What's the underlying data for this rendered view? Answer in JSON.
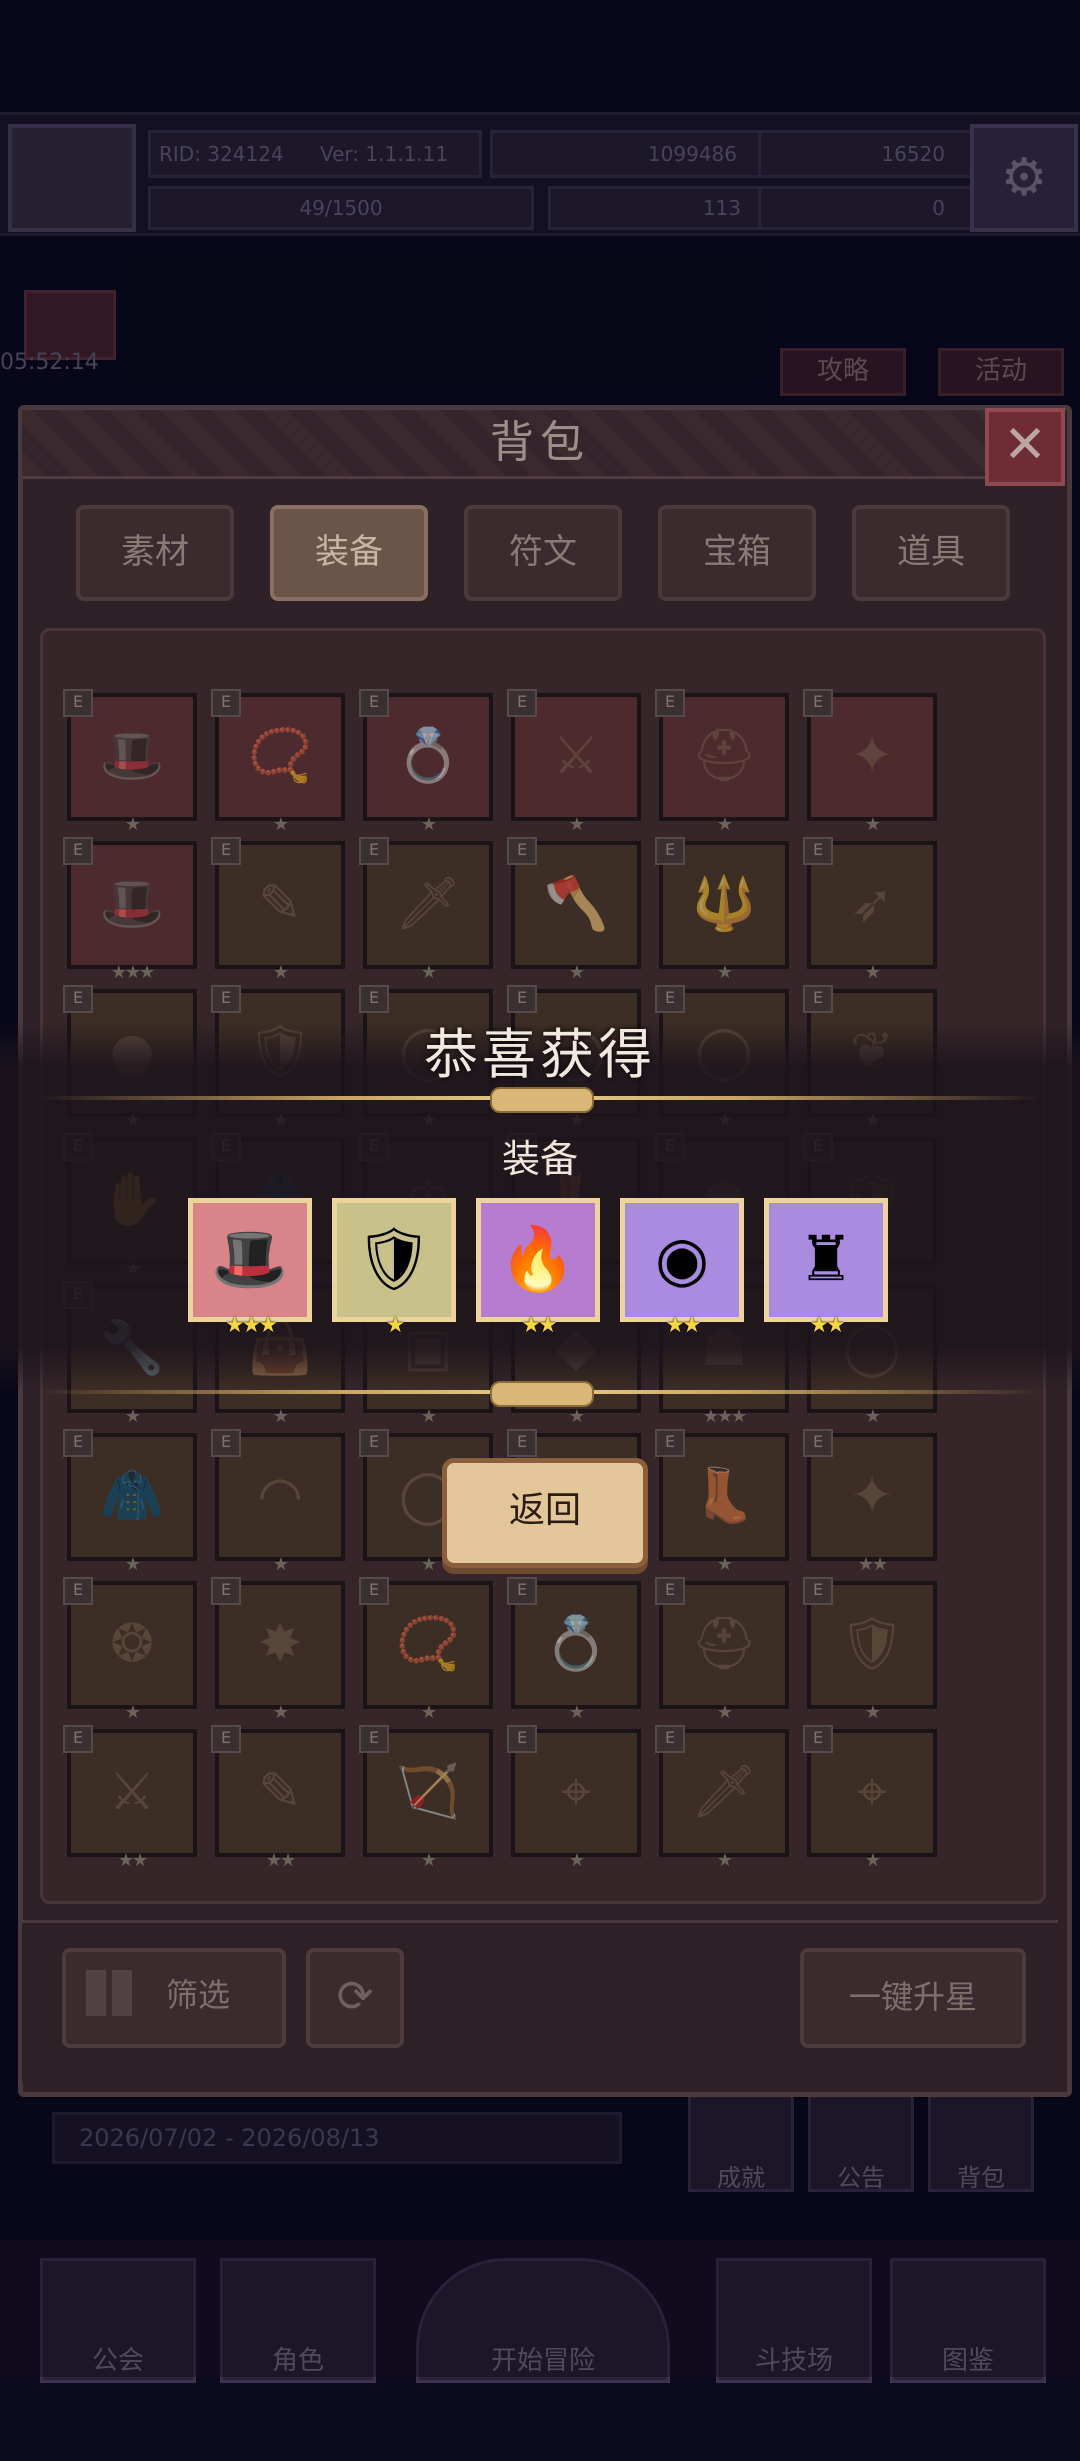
{
  "top_bar": {
    "rid": "RID: 324124",
    "version": "Ver: 1.1.1.11",
    "gold": "1099486",
    "gems": "16520",
    "stamina": "49/1500",
    "clover": "113",
    "key": "0"
  },
  "side": {
    "timer": "05:52:14",
    "guide_label": "攻略",
    "activity_label": "活动"
  },
  "panel": {
    "title": "背包",
    "close_icon": "close-icon",
    "tabs": [
      {
        "label": "素材",
        "active": false
      },
      {
        "label": "装备",
        "active": true
      },
      {
        "label": "符文",
        "active": false
      },
      {
        "label": "宝箱",
        "active": false
      },
      {
        "label": "道具",
        "active": false
      }
    ],
    "grid": [
      [
        {
          "icon": "hat-icon",
          "glyph": "🎩",
          "bg": "red",
          "stars": 1
        },
        {
          "icon": "necklace-icon",
          "glyph": "📿",
          "bg": "red",
          "stars": 1
        },
        {
          "icon": "ring-icon",
          "glyph": "💍",
          "bg": "red",
          "stars": 1
        },
        {
          "icon": "crossed-swords-icon",
          "glyph": "⚔",
          "bg": "red",
          "stars": 1
        },
        {
          "icon": "helmet-icon",
          "glyph": "⛑",
          "bg": "red",
          "stars": 1
        },
        {
          "icon": "amulet-icon",
          "glyph": "✦",
          "bg": "red",
          "stars": 1
        }
      ],
      [
        {
          "icon": "cap-icon",
          "glyph": "🎩",
          "bg": "red",
          "stars": 3
        },
        {
          "icon": "staff-icon",
          "glyph": "✎",
          "bg": "tan",
          "stars": 1
        },
        {
          "icon": "sword-icon",
          "glyph": "🗡",
          "bg": "tan",
          "stars": 1
        },
        {
          "icon": "axe-icon",
          "glyph": "🪓",
          "bg": "tan",
          "stars": 1
        },
        {
          "icon": "trident-icon",
          "glyph": "🔱",
          "bg": "tan",
          "stars": 1
        },
        {
          "icon": "spear-icon",
          "glyph": "➶",
          "bg": "tan",
          "stars": 1
        }
      ],
      [
        {
          "icon": "orb-icon",
          "glyph": "●",
          "bg": "tan",
          "stars": 1
        },
        {
          "icon": "armor-icon",
          "glyph": "🛡",
          "bg": "tan",
          "stars": 1
        },
        {
          "icon": "ring-icon",
          "glyph": "◯",
          "bg": "tan",
          "stars": 1
        },
        {
          "icon": "ring-icon",
          "glyph": "◯",
          "bg": "tan",
          "stars": 1
        },
        {
          "icon": "ring-icon",
          "glyph": "◯",
          "bg": "tan",
          "stars": 1
        },
        {
          "icon": "pendant-icon",
          "glyph": "❦",
          "bg": "tan",
          "stars": 1
        }
      ],
      [
        {
          "icon": "gauntlet-icon",
          "glyph": "✋",
          "bg": "tan",
          "stars": 1
        },
        {
          "icon": "cloak-icon",
          "glyph": "🧥",
          "bg": "tan",
          "stars": 1
        },
        {
          "icon": "crown-icon",
          "glyph": "♔",
          "bg": "tan",
          "stars": 1
        },
        {
          "icon": "boots-icon",
          "glyph": "👢",
          "bg": "tan",
          "stars": 1
        },
        {
          "icon": "mask-icon",
          "glyph": "☗",
          "bg": "tan",
          "stars": 1
        },
        {
          "icon": "armor-icon",
          "glyph": "🛡",
          "bg": "tan",
          "stars": 1
        }
      ],
      [
        {
          "icon": "wrench-icon",
          "glyph": "🔧",
          "bg": "tan",
          "stars": 1
        },
        {
          "icon": "bag-icon",
          "glyph": "👜",
          "bg": "tan",
          "stars": 1
        },
        {
          "icon": "chest-icon",
          "glyph": "▣",
          "bg": "tan",
          "stars": 1
        },
        {
          "icon": "gem-icon",
          "glyph": "◆",
          "bg": "tan",
          "stars": 1
        },
        {
          "icon": "mask-icon",
          "glyph": "☗",
          "bg": "tan",
          "stars": 3
        },
        {
          "icon": "ring-icon",
          "glyph": "◯",
          "bg": "tan",
          "stars": 1
        }
      ],
      [
        {
          "icon": "cloak-icon",
          "glyph": "🧥",
          "bg": "tan",
          "stars": 1
        },
        {
          "icon": "circlet-icon",
          "glyph": "◠",
          "bg": "tan",
          "stars": 1
        },
        {
          "icon": "ring-icon",
          "glyph": "◯",
          "bg": "tan",
          "stars": 1
        },
        {
          "icon": "gem-icon",
          "glyph": "◆",
          "bg": "tan",
          "stars": 1
        },
        {
          "icon": "boots-icon",
          "glyph": "👢",
          "bg": "tan",
          "stars": 1
        },
        {
          "icon": "amulet-icon",
          "glyph": "✦",
          "bg": "tan",
          "stars": 2
        }
      ],
      [
        {
          "icon": "amulet-icon",
          "glyph": "❂",
          "bg": "tan",
          "stars": 1
        },
        {
          "icon": "gem-icon",
          "glyph": "✸",
          "bg": "tan",
          "stars": 1
        },
        {
          "icon": "necklace-icon",
          "glyph": "📿",
          "bg": "tan",
          "stars": 1
        },
        {
          "icon": "ring-icon",
          "glyph": "💍",
          "bg": "tan",
          "stars": 1
        },
        {
          "icon": "helmet-icon",
          "glyph": "⛑",
          "bg": "tan",
          "stars": 1
        },
        {
          "icon": "armor-icon",
          "glyph": "🛡",
          "bg": "tan",
          "stars": 1
        }
      ],
      [
        {
          "icon": "crossed-swords-icon",
          "glyph": "⚔",
          "bg": "tan",
          "stars": 2
        },
        {
          "icon": "wand-icon",
          "glyph": "✎",
          "bg": "tan",
          "stars": 2
        },
        {
          "icon": "bow-icon",
          "glyph": "🏹",
          "bg": "tan",
          "stars": 1
        },
        {
          "icon": "crossbow-icon",
          "glyph": "⌖",
          "bg": "tan",
          "stars": 1
        },
        {
          "icon": "dagger-icon",
          "glyph": "🗡",
          "bg": "tan",
          "stars": 1
        },
        {
          "icon": "crossbow-icon",
          "glyph": "⌖",
          "bg": "tan",
          "stars": 1
        }
      ]
    ],
    "filter_label": "筛选",
    "upgrade_all_label": "一键升星"
  },
  "behind": {
    "date_range": "2026/07/02 - 2026/08/13",
    "achievement_label": "成就",
    "notice_label": "公告",
    "bag_label": "背包",
    "nav": [
      "公会",
      "角色",
      "开始冒险",
      "斗技场",
      "图鉴"
    ]
  },
  "reward": {
    "title": "恭喜获得",
    "subtitle": "装备",
    "items": [
      {
        "icon": "cap-icon",
        "glyph": "🎩",
        "bg": "#d98488",
        "stars": 3
      },
      {
        "icon": "armor-icon",
        "glyph": "🛡",
        "bg": "#c8c28a",
        "stars": 1
      },
      {
        "icon": "shield-icon",
        "glyph": "🔥",
        "bg": "#b57ccf",
        "stars": 2
      },
      {
        "icon": "orb-icon",
        "glyph": "◉",
        "bg": "#a98be0",
        "stars": 2
      },
      {
        "icon": "armor-icon",
        "glyph": "♜",
        "bg": "#a98be0",
        "stars": 2
      }
    ],
    "return_label": "返回"
  }
}
